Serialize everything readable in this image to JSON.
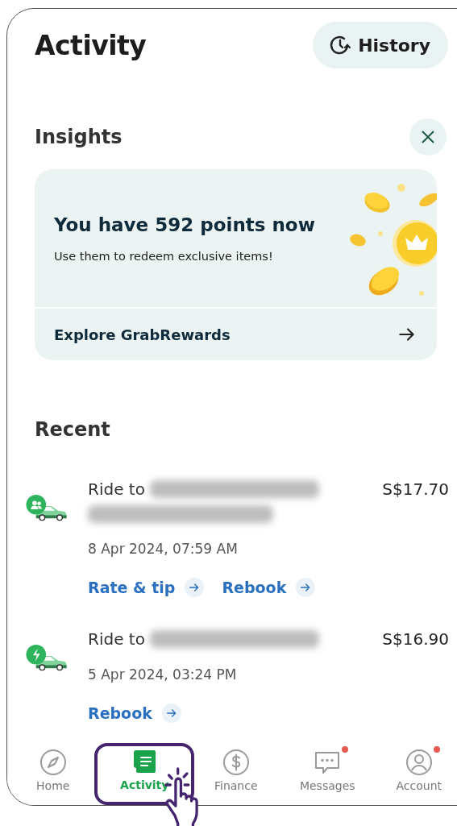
{
  "header": {
    "title": "Activity",
    "history_button": "History"
  },
  "insights": {
    "title": "Insights",
    "card": {
      "headline": "You have 592 points now",
      "subtitle": "Use them to redeem exclusive items!",
      "link": "Explore GrabRewards"
    }
  },
  "recent": {
    "title": "Recent",
    "rides": [
      {
        "kind": "group",
        "title": "Ride to",
        "price": "S$17.70",
        "date": "8 Apr 2024, 07:59 AM",
        "address_wrapped": true,
        "actions": [
          "Rate & tip",
          "Rebook"
        ]
      },
      {
        "kind": "express",
        "title": "Ride to",
        "price": "S$16.90",
        "date": "5 Apr 2024, 03:24 PM",
        "address_wrapped": false,
        "actions": [
          "Rebook"
        ]
      }
    ]
  },
  "nav": [
    {
      "kind": "home",
      "label": "Home",
      "selected": false,
      "dot": false
    },
    {
      "kind": "activity",
      "label": "Activity",
      "selected": true,
      "highlighted": true,
      "dot": false
    },
    {
      "kind": "finance",
      "label": "Finance",
      "selected": false,
      "dot": false
    },
    {
      "kind": "messages",
      "label": "Messages",
      "selected": false,
      "dot": true
    },
    {
      "kind": "account",
      "label": "Account",
      "selected": false,
      "dot": true
    }
  ]
}
